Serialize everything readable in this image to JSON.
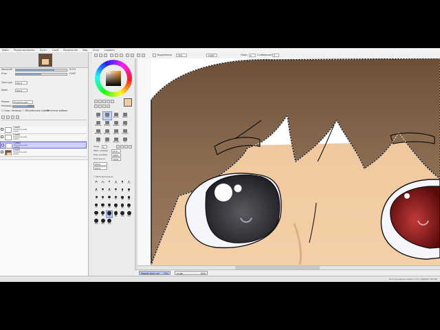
{
  "menubar": {
    "items": [
      "Файл",
      "Редактирование",
      "Холст",
      "Слой",
      "Выделение",
      "Вид",
      "Окно",
      "Справка"
    ]
  },
  "toolbar": {
    "selection_source_label": "Выделение",
    "zoom_value": "75%",
    "rotation_value": "+000°",
    "normal_label": "Норм",
    "stabilizer_label": "Стабилизатор",
    "stabilizer_value": "3"
  },
  "left_panel": {
    "nav_zoom_label": "Масштаб",
    "nav_zoom_value": "75.0%",
    "nav_angle_label": "Угол",
    "nav_angle_value": "+000°",
    "paper_texture_label": "Текстура",
    "paper_texture_value": "[Нет]",
    "border_label": "Край",
    "border_value": "[Нет]",
    "blend_label": "Режим",
    "blend_value": "Нормальный",
    "opacity_label": "Непрозр.",
    "opacity_value": "100%",
    "preserve_opacity_label": "Сохр. непрозр.",
    "clipping_label": "Обтравочная группа",
    "selection_source_label": "Источник выбора",
    "layers": [
      {
        "name": "Слой3",
        "mode": "Нормальный",
        "opacity": "100%",
        "selected": false,
        "thumb": "blank"
      },
      {
        "name": "Слой4",
        "mode": "Нормальный",
        "opacity": "100%",
        "selected": false,
        "thumb": "blank"
      },
      {
        "name": "Слой2",
        "mode": "Нормальный",
        "opacity": "100%",
        "selected": true,
        "thumb": "blank"
      },
      {
        "name": "Слой1",
        "mode": "Нормальный",
        "opacity": "100%",
        "selected": false,
        "thumb": "face"
      }
    ]
  },
  "tool_panel": {
    "tools": [
      {
        "name": "Pen",
        "label": "Pen"
      },
      {
        "name": "AirBrush",
        "label": "AirBr"
      },
      {
        "name": "Brush",
        "label": "Brush"
      },
      {
        "name": "Water",
        "label": "Water"
      },
      {
        "name": "Marker",
        "label": "Marker"
      },
      {
        "name": "Eraser",
        "label": "Eraser"
      },
      {
        "name": "SelPen",
        "label": "SelPen"
      },
      {
        "name": "SelErase",
        "label": "SelEr"
      },
      {
        "name": "Bucket",
        "label": "Bucket"
      },
      {
        "name": "Binary",
        "label": "Binary"
      },
      {
        "name": "Pencil",
        "label": "Pencil"
      },
      {
        "name": "Crayon",
        "label": "Crayon"
      },
      {
        "name": "Flat",
        "label": "Flat"
      },
      {
        "name": "Blur",
        "label": "Blur"
      },
      {
        "name": "Rough",
        "label": "Rough"
      },
      {
        "name": "Oil",
        "label": "Oil"
      }
    ],
    "blend_label": "Норм",
    "max_size_label": "Макс. размер",
    "max_size_value": "13.0",
    "min_size_label": "Мин. размер",
    "min_size_value": "100%",
    "density_label": "Плотность",
    "density_value": "100%",
    "shape_label": "[Нет]",
    "texture_label": "[Нет]",
    "advanced_label": "Дополнительно",
    "brush_sizes": [
      "0.7",
      "0.8",
      "1",
      "1.5",
      "2",
      "2.3",
      "2.6",
      "3",
      "3.5",
      "4",
      "5",
      "6",
      "7",
      "8",
      "9",
      "10",
      "12",
      "14",
      "16",
      "20",
      "25",
      "30",
      "35",
      "40",
      "50",
      "60",
      "70",
      "80",
      "100",
      "120",
      "160",
      "200",
      "250"
    ]
  },
  "colors": {
    "primary_swatch": "#f2c9a2",
    "hair": "#7b5c43",
    "skin": "#efc79c",
    "eye_dark": "#3b3b40",
    "eye_red": "#8a1a1a",
    "selected_layer": "#cfd0ff"
  },
  "statusbar": {
    "tab1_label": "Новый холст.sai",
    "tab1_zoom": "75%",
    "tab2_label": "zu.sai",
    "tab2_zoom": "50%"
  },
  "bottombar": {
    "info": "Использование памяти 27% (ЗДРАВ) 781 МБ"
  }
}
